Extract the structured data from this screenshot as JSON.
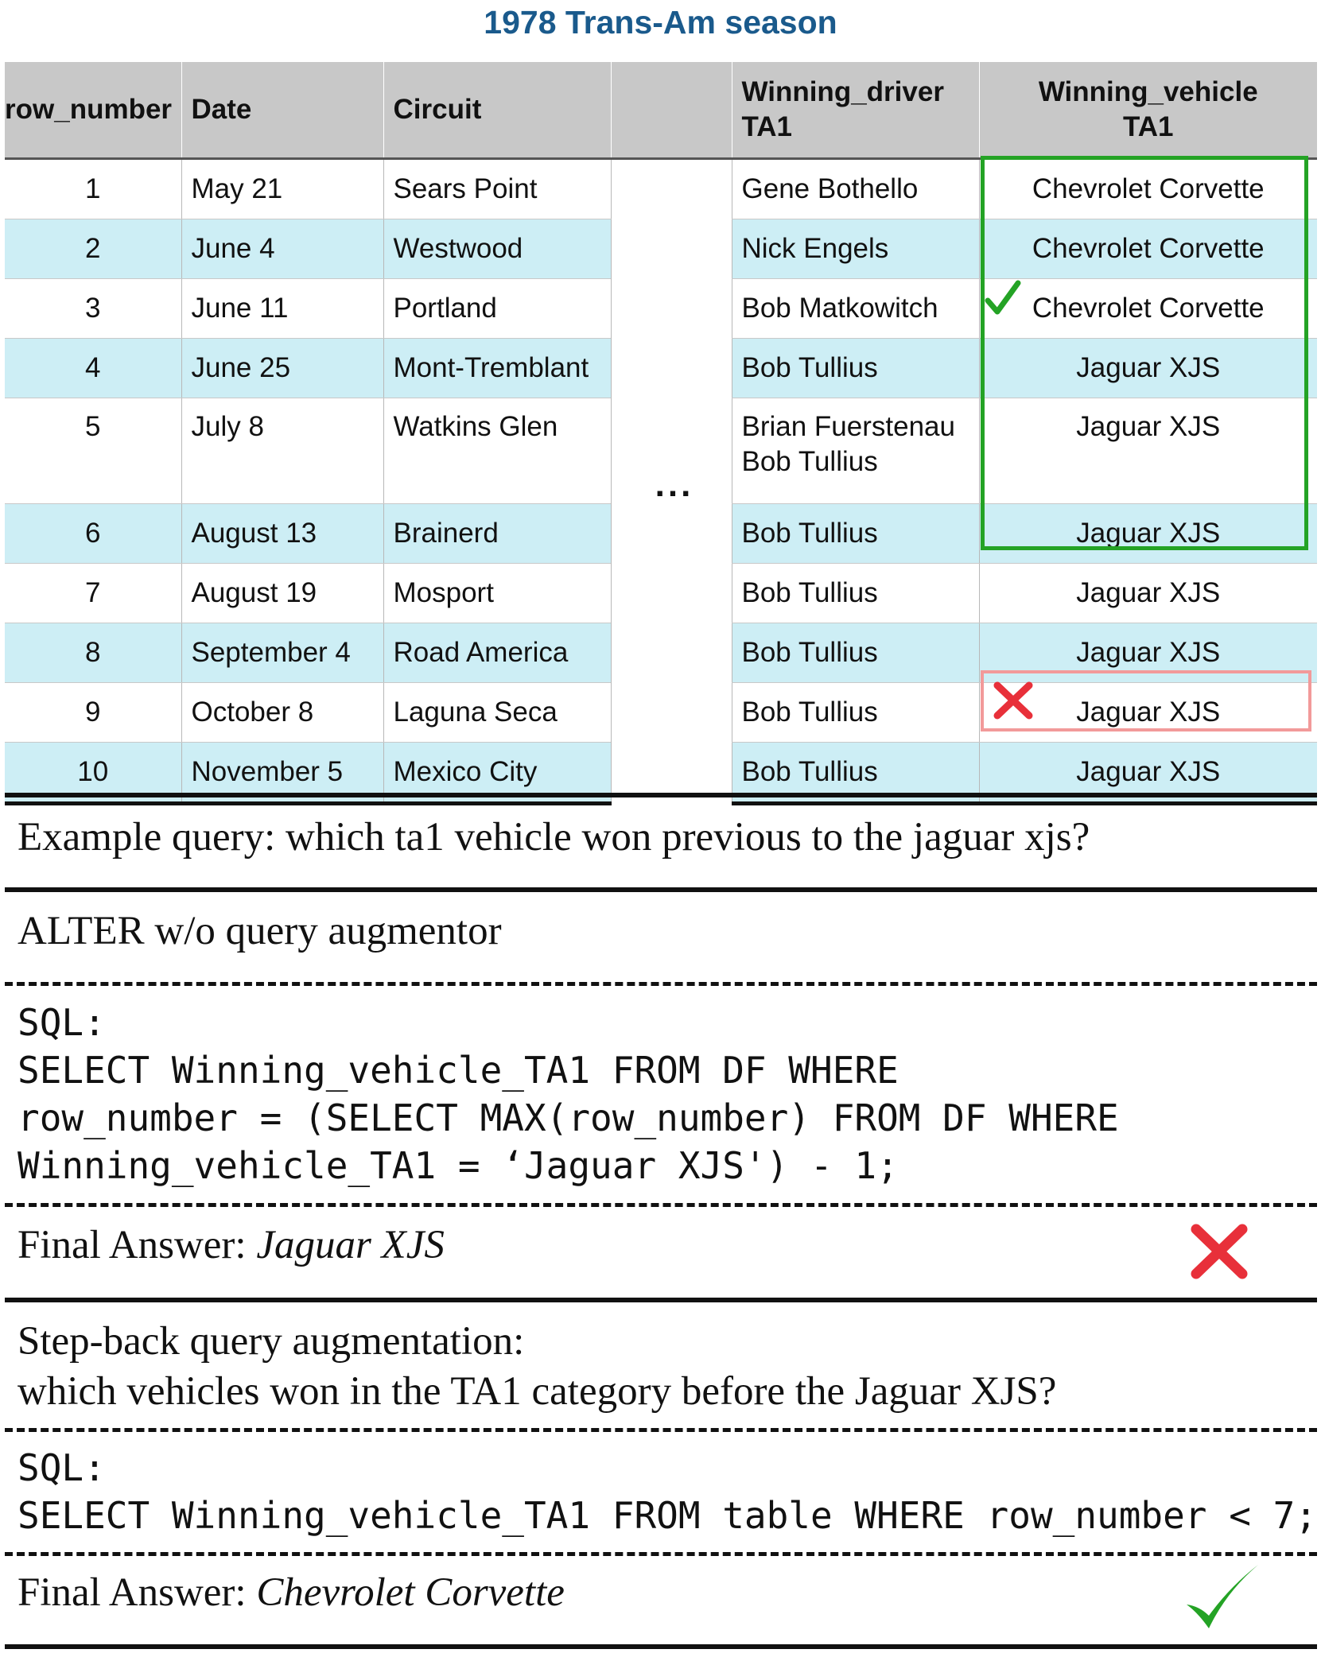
{
  "title": "1978 Trans-Am season",
  "table": {
    "headers": [
      "row_number",
      "Date",
      "Circuit",
      "",
      "Winning_driver TA1",
      "Winning_vehicle TA1"
    ],
    "header_lines": {
      "driver": [
        "Winning_driver",
        "TA1"
      ],
      "vehicle": [
        "Winning_vehicle",
        "TA1"
      ]
    },
    "ellipsis": "...",
    "rows": [
      {
        "n": "1",
        "date": "May 21",
        "circuit": "Sears Point",
        "driver": [
          "Gene Bothello"
        ],
        "vehicle": "Chevrolet Corvette"
      },
      {
        "n": "2",
        "date": "June 4",
        "circuit": "Westwood",
        "driver": [
          "Nick Engels"
        ],
        "vehicle": "Chevrolet Corvette"
      },
      {
        "n": "3",
        "date": "June 11",
        "circuit": "Portland",
        "driver": [
          "Bob Matkowitch"
        ],
        "vehicle": "Chevrolet Corvette"
      },
      {
        "n": "4",
        "date": "June 25",
        "circuit": "Mont-Tremblant",
        "driver": [
          "Bob Tullius"
        ],
        "vehicle": "Jaguar XJS"
      },
      {
        "n": "5",
        "date": "July 8",
        "circuit": "Watkins Glen",
        "driver": [
          "Brian Fuerstenau",
          "Bob Tullius"
        ],
        "vehicle": "Jaguar XJS"
      },
      {
        "n": "6",
        "date": "August 13",
        "circuit": "Brainerd",
        "driver": [
          "Bob Tullius"
        ],
        "vehicle": "Jaguar XJS"
      },
      {
        "n": "7",
        "date": "August 19",
        "circuit": "Mosport",
        "driver": [
          "Bob Tullius"
        ],
        "vehicle": "Jaguar XJS"
      },
      {
        "n": "8",
        "date": "September 4",
        "circuit": "Road America",
        "driver": [
          "Bob Tullius"
        ],
        "vehicle": "Jaguar XJS"
      },
      {
        "n": "9",
        "date": "October 8",
        "circuit": "Laguna Seca",
        "driver": [
          "Bob Tullius"
        ],
        "vehicle": "Jaguar XJS"
      },
      {
        "n": "10",
        "date": "November 5",
        "circuit": "Mexico City",
        "driver": [
          "Bob Tullius"
        ],
        "vehicle": "Jaguar XJS"
      }
    ],
    "highlight_colors": {
      "correct": "#24a325",
      "wrong": "#f29a9a",
      "row_alt": "#cdeef5",
      "header_bg": "#c8c8c8"
    }
  },
  "query": "Example query: which ta1 vehicle won previous to the jaguar xjs?",
  "alter": {
    "heading": "ALTER w/o query augmentor",
    "sql_lines": [
      "SQL:",
      "SELECT Winning_vehicle_TA1 FROM DF WHERE",
      "row_number = (SELECT MAX(row_number) FROM DF WHERE",
      "Winning_vehicle_TA1 = ‘Jaguar XJS') - 1;"
    ],
    "answer_prefix": "Final Answer: ",
    "answer": "Jaguar XJS",
    "verdict_icon": "red-cross-icon"
  },
  "stepback": {
    "heading": "Step-back query augmentation:",
    "question": "which vehicles won in the TA1 category before the Jaguar XJS?",
    "sql_lines": [
      "SQL:",
      "SELECT Winning_vehicle_TA1 FROM table WHERE row_number < 7;"
    ],
    "answer_prefix": "Final Answer: ",
    "answer": "Chevrolet Corvette",
    "verdict_icon": "green-check-icon"
  }
}
